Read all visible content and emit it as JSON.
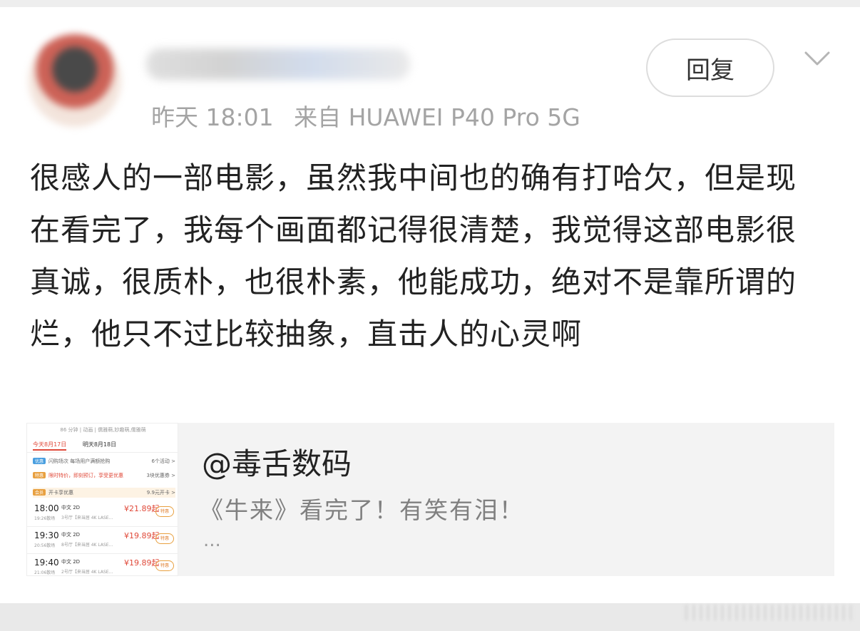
{
  "post": {
    "meta": {
      "time": "昨天 18:01",
      "source": "来自 HUAWEI P40 Pro 5G"
    },
    "reply_label": "回复",
    "text": "很感人的一部电影，虽然我中间也的确有打哈欠，但是现在看完了，我每个画面都记得很清楚，我觉得这部电影很真诚，很质朴，也很朴素，他能成功，绝对不是靠所谓的烂，他只不过比较抽象，直击人的心灵啊"
  },
  "quote": {
    "author": "@毒舌数码",
    "text": "《牛来》看完了！有笑有泪！",
    "more": "..."
  },
  "thumbnail": {
    "top": "86 分钟 | 动画 | 儒雅萌,妙趣萌,儒雅萌",
    "tabs": [
      "今天8月17日",
      "明天8月18日"
    ],
    "rows": [
      {
        "tag": "优惠",
        "text": "闪购场次  每场用户满额抢购",
        "right": "6个活动 >"
      },
      {
        "tag": "特惠",
        "text": "限时特价，即刻预订，享受更优惠",
        "right": "3块优惠券 >"
      },
      {
        "tag": "会员",
        "text": "开卡享优惠",
        "right": "9.9元开卡 >"
      }
    ],
    "showtimes": [
      {
        "time": "18:00",
        "end": "19:26散场",
        "lang": "中文 2D",
        "hall": "3号厅【来当居 4K LASE...",
        "price": "¥21.89起",
        "btn": "特惠"
      },
      {
        "time": "19:30",
        "end": "20:56散场",
        "lang": "中文 2D",
        "hall": "8号厅【来当居 4K LASE...",
        "price": "¥19.89起",
        "btn": "特惠"
      },
      {
        "time": "19:40",
        "end": "21:06散场",
        "lang": "中文 2D",
        "hall": "2号厅【来当居 4K LASE...",
        "price": "¥19.89起",
        "btn": "特惠"
      }
    ]
  },
  "colors": {
    "meta_gray": "#a4a4a4",
    "text_dark": "#222222",
    "quote_bg": "#f3f3f3",
    "price_red": "#e04a3a"
  }
}
